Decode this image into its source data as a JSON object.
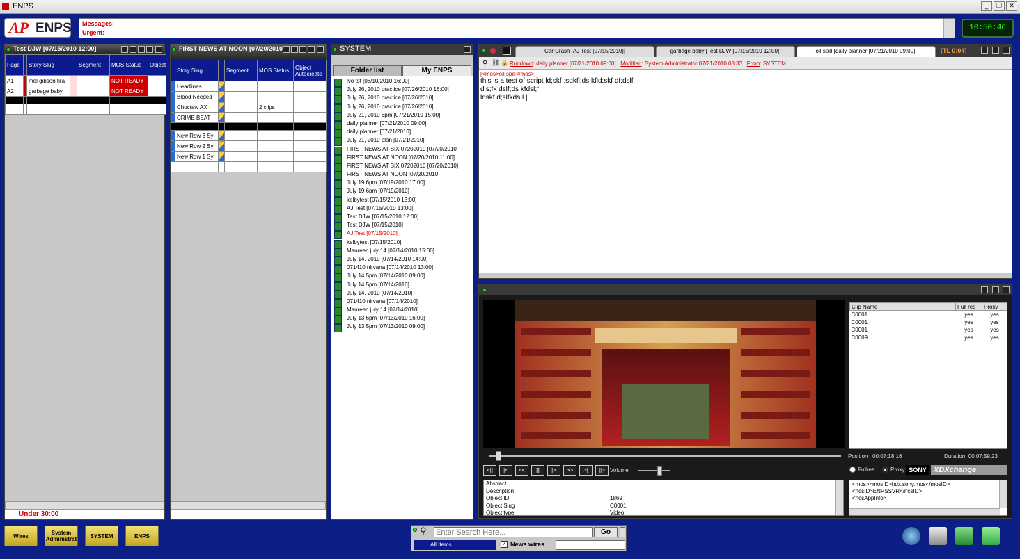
{
  "app": {
    "title": "ENPS",
    "logo_ap": "AP",
    "logo_enps": "ENPS",
    "clock": "10:50:46"
  },
  "messages": {
    "messages_label": "Messages:",
    "urgent_label": "Urgent:"
  },
  "rundown1": {
    "title": "Test DJW [07/15/2010 12:00]",
    "headers": [
      "Page",
      "",
      "Story Slug",
      "",
      "Segment",
      "MOS Status",
      "Object Autocr"
    ],
    "rows": [
      {
        "page": "A1",
        "slug": "mel gibson tira",
        "status": "NOT READY"
      },
      {
        "page": "A2",
        "slug": "garbage baby",
        "status": "NOT READY"
      }
    ],
    "footer": "Under 30:00"
  },
  "rundown2": {
    "title": "FIRST NEWS AT NOON [07/20/2010]",
    "headers": [
      "",
      "Story Slug",
      "",
      "Segment",
      "MOS Status",
      "Object Autocreate"
    ],
    "rows": [
      {
        "slug": "Headlines",
        "status": ""
      },
      {
        "slug": "Blood Needed",
        "status": ""
      },
      {
        "slug": "Choctaw AX",
        "status": "2 clips"
      },
      {
        "slug": "CRIME BEAT",
        "status": ""
      }
    ],
    "rows2": [
      {
        "slug": "New Row 3 Sy"
      },
      {
        "slug": "New Row 2 Sy"
      },
      {
        "slug": "New Row 1 Sy"
      }
    ]
  },
  "system": {
    "title": "SYSTEM",
    "tab_folder": "Folder list",
    "tab_my": "My ENPS",
    "items": [
      "lvo tst [08/10/2010 16:00]",
      "July 26, 2010 practice [07/26/2010 16:00]",
      "July 26, 2010 practice [07/26/2010]",
      "July 26, 2010 practice [07/26/2010]",
      "July 21, 2010 6pm [07/21/2010 15:00]",
      "daily planner [07/21/2010 09:00]",
      "daily planner [07/21/2010]",
      "July 21, 2010 plan [07/21/2010]",
      "FIRST NEWS AT SIX 07202010 [07/20/2010",
      "FIRST NEWS AT NOON [07/20/2010 11:00]",
      "FIRST NEWS AT SIX 07202010 [07/20/2010]",
      "FIRST NEWS AT NOON [07/20/2010]",
      "July 19 6pm [07/19/2010 17:00]",
      "July 19 6pm [07/19/2010]",
      "kelbytest [07/15/2010 13:00]",
      "AJ Test [07/15/2010 13:00]",
      "Test DJW [07/15/2010 12:00]",
      "Test DJW [07/15/2010]",
      "AJ Test [07/15/2010]",
      "kelbytest [07/15/2010]",
      "Maureen july 14 [07/14/2010 15:00]",
      "July 14, 2010 [07/14/2010 14:00]",
      "071410 nirvana [07/14/2010 13:00]",
      "July 14 5pm [07/14/2010 09:00]",
      "July 14 5pm [07/14/2010]",
      "July 14, 2010 [07/14/2010]",
      "071410 nirvana [07/14/2010]",
      "Maureen july 14 [07/14/2010]",
      "July 13 6pm [07/13/2010 16:00]",
      "July 13 5pm [07/13/2010 09:00]"
    ],
    "highlight_index": 18
  },
  "script": {
    "tabs": [
      "Car Crash [AJ Test [07/15/2010]]",
      "garbage baby [Test DJW [07/15/2010 12:00]]",
      "oil spill [daily planner [07/21/2010 09:00]]"
    ],
    "tl": "[TL 0:04]",
    "rundown_label": "Rundown",
    "rundown_value": "daily planner [07/21/2010 09:00]",
    "modified_label": "Modified",
    "modified_value": "System Administrator   07/21/2010 08:33",
    "from_label": "From",
    "from_value": "SYSTEM",
    "mos_tag": "[<mos>oil spill</mos>]",
    "lines": [
      "this is a test of script ld;skf ;sdkfl;ds kfld;skf df;dslf",
      "dls;fk dslf;ds kfdsl;f",
      "ldskf d;slfkds;l |"
    ]
  },
  "media": {
    "clip_headers": [
      "Clip Name",
      "Full res",
      "Proxy"
    ],
    "clips": [
      {
        "name": "C0001",
        "full": "yes",
        "proxy": "yes"
      },
      {
        "name": "C0001",
        "full": "yes",
        "proxy": "yes"
      },
      {
        "name": "C0001",
        "full": "yes",
        "proxy": "yes"
      },
      {
        "name": "C0009",
        "full": "yes",
        "proxy": "yes"
      }
    ],
    "position_label": "Position",
    "position": "00:07:18;16",
    "duration_label": "Duration",
    "duration": "00:07:59;23",
    "volume_label": "Volume",
    "volume_level": 0.6,
    "fullres_label": "Fullres",
    "proxy_label": "Proxy",
    "sony_label": "SONY",
    "xchange_label": "XDXchange",
    "playhead": 0.02,
    "controls": [
      "<||",
      "|<",
      "<<",
      "[]",
      "|>",
      ">>",
      ">|",
      "||>"
    ],
    "meta": [
      {
        "k": "Abstract",
        "v": ""
      },
      {
        "k": "Description",
        "v": ""
      },
      {
        "k": "Object ID",
        "v": "1869"
      },
      {
        "k": "Object Slug",
        "v": "C0001"
      },
      {
        "k": "Object type",
        "v": "Video"
      }
    ],
    "xml": [
      "<mos><mosID>hdx.sony.mos</mosID>",
      "<ncsID>ENPSSVR</ncsID>",
      "<ncsAppInfo>"
    ]
  },
  "taskbar": {
    "buttons": [
      "Wires",
      "System Administrat",
      "SYSTEM",
      "ENPS"
    ],
    "search_placeholder": "Enter Search Here...",
    "go": "Go",
    "all_items": "All Items",
    "news_wires": "News wires"
  }
}
